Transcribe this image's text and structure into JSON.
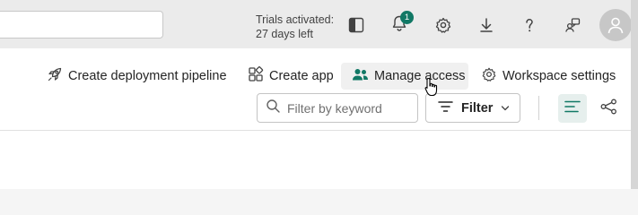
{
  "header": {
    "trial_line1": "Trials activated:",
    "trial_line2": "27 days left",
    "notifications_count": "1",
    "icons": [
      "layout-panel-icon",
      "bell-icon",
      "settings-icon",
      "download-icon",
      "help-icon",
      "feedback-icon",
      "avatar-icon"
    ]
  },
  "toolbar": {
    "deploy_label": "Create deployment pipeline",
    "app_label": "Create app",
    "access_label": "Manage access",
    "settings_label": "Workspace settings"
  },
  "filter": {
    "placeholder": "Filter by keyword",
    "button_label": "Filter"
  },
  "colors": {
    "accent": "#117865"
  }
}
